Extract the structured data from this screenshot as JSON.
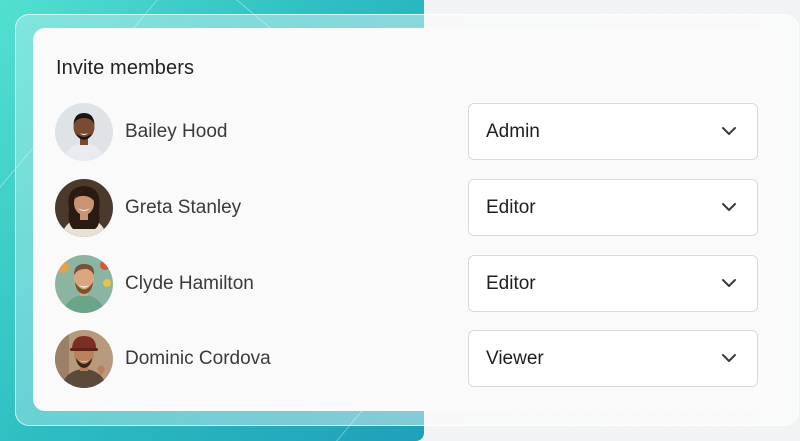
{
  "panel": {
    "title": "Invite members"
  },
  "members": [
    {
      "name": "Bailey Hood",
      "role": "Admin",
      "avatar_icon": "person-photo-avatar",
      "avatar_bg": "#dfe3e6",
      "skin": "#7a4b30",
      "hair": "#1c1410",
      "shirt": "#e8ecf0"
    },
    {
      "name": "Greta Stanley",
      "role": "Editor",
      "avatar_icon": "person-photo-avatar",
      "avatar_bg": "#4b3a2c",
      "skin": "#c99474",
      "hair": "#2a1a12",
      "shirt": "#e8e1d6"
    },
    {
      "name": "Clyde Hamilton",
      "role": "Editor",
      "avatar_icon": "person-photo-avatar",
      "avatar_bg": "#8bb4a2",
      "skin": "#d9a67e",
      "hair": "#7a5230",
      "shirt": "#6aa58a"
    },
    {
      "name": "Dominic Cordova",
      "role": "Viewer",
      "avatar_icon": "person-photo-avatar",
      "avatar_bg": "#b79a7e",
      "skin": "#b77f5c",
      "hair": "#3b2418",
      "shirt": "#5a4a3a"
    }
  ],
  "colors": {
    "accent_gradient_start": "#52e0cf",
    "accent_gradient_end": "#1f9fb9",
    "card_bg": "#fafafa",
    "select_border": "#dadada",
    "chevron": "#3a3a3a"
  }
}
